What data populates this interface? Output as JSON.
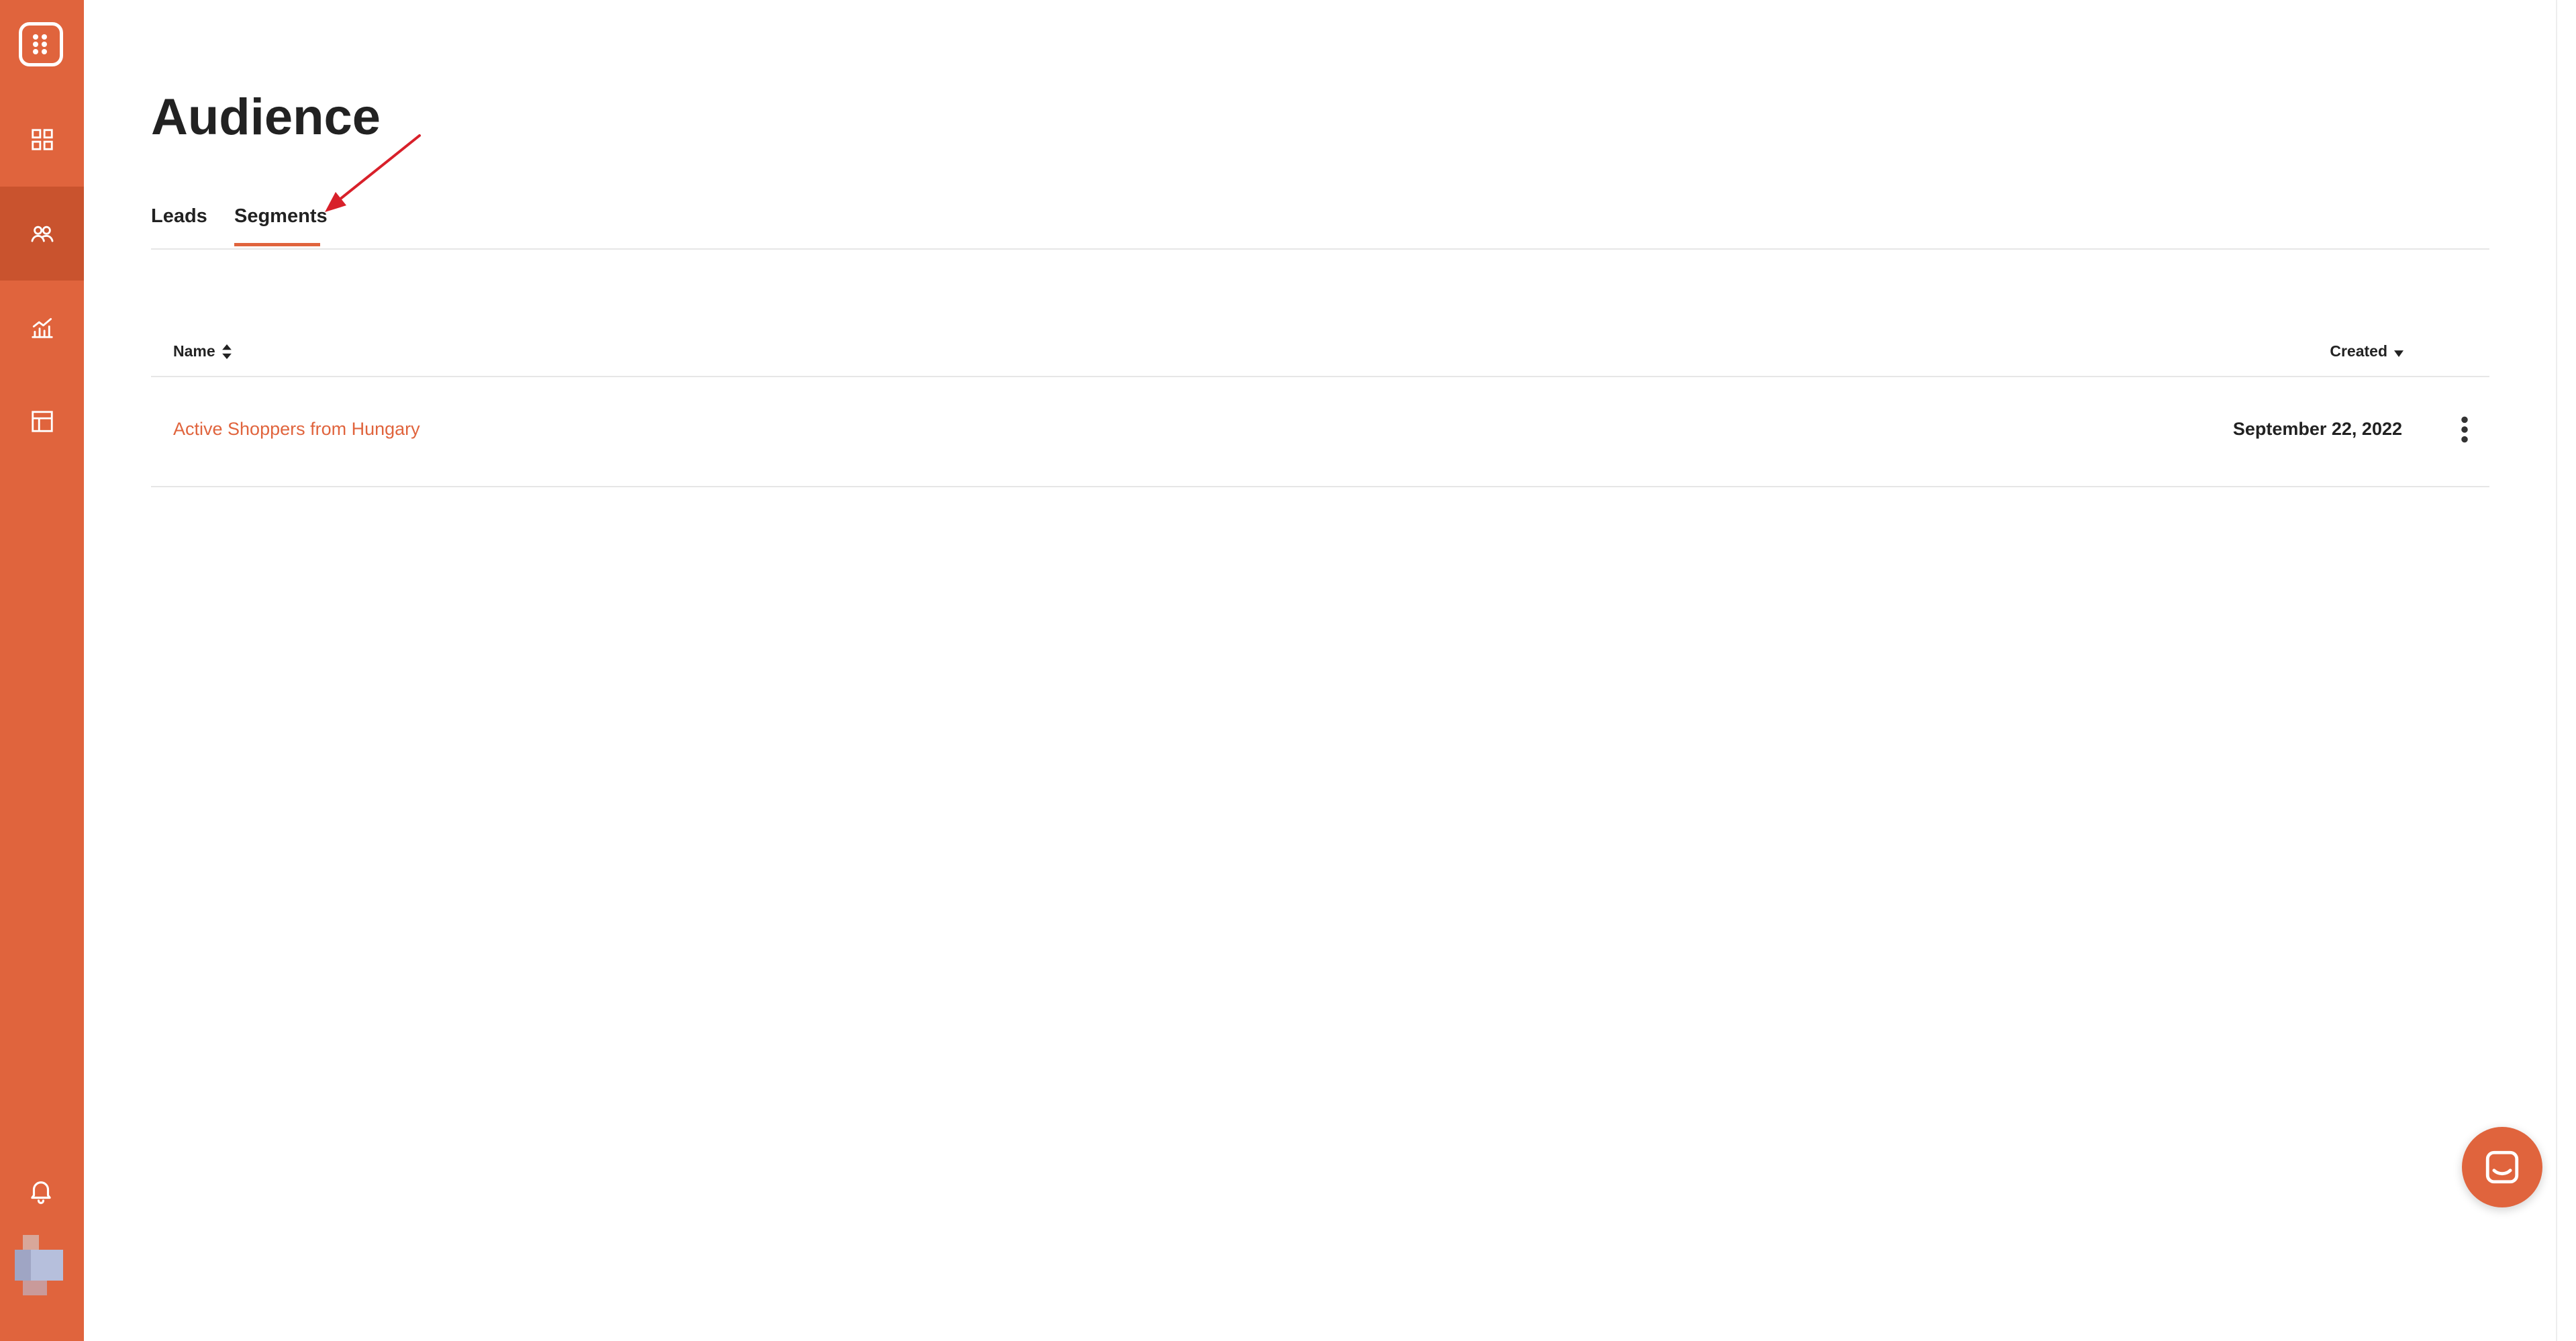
{
  "page": {
    "title": "Audience"
  },
  "tabs": [
    {
      "label": "Leads",
      "active": false
    },
    {
      "label": "Segments",
      "active": true
    }
  ],
  "table": {
    "columns": [
      {
        "label": "Name",
        "sort": "both"
      },
      {
        "label": "Created",
        "sort": "descending"
      }
    ],
    "rows": [
      {
        "name": "Active Shoppers from Hungary",
        "created": "September 22, 2022"
      }
    ]
  },
  "sidebar": {
    "items": [
      {
        "icon": "dashboard-grid-icon",
        "active": false
      },
      {
        "icon": "users-icon",
        "active": true
      },
      {
        "icon": "analytics-chart-icon",
        "active": false
      },
      {
        "icon": "layout-template-icon",
        "active": false
      }
    ],
    "bottom": [
      {
        "icon": "bell-icon"
      },
      {
        "icon": "avatar"
      }
    ]
  },
  "colors": {
    "accent": "#e0643d",
    "sidebar_active": "#c9532e",
    "annotation": "#d8202a",
    "text": "#222222",
    "divider": "#e6e6e6"
  }
}
